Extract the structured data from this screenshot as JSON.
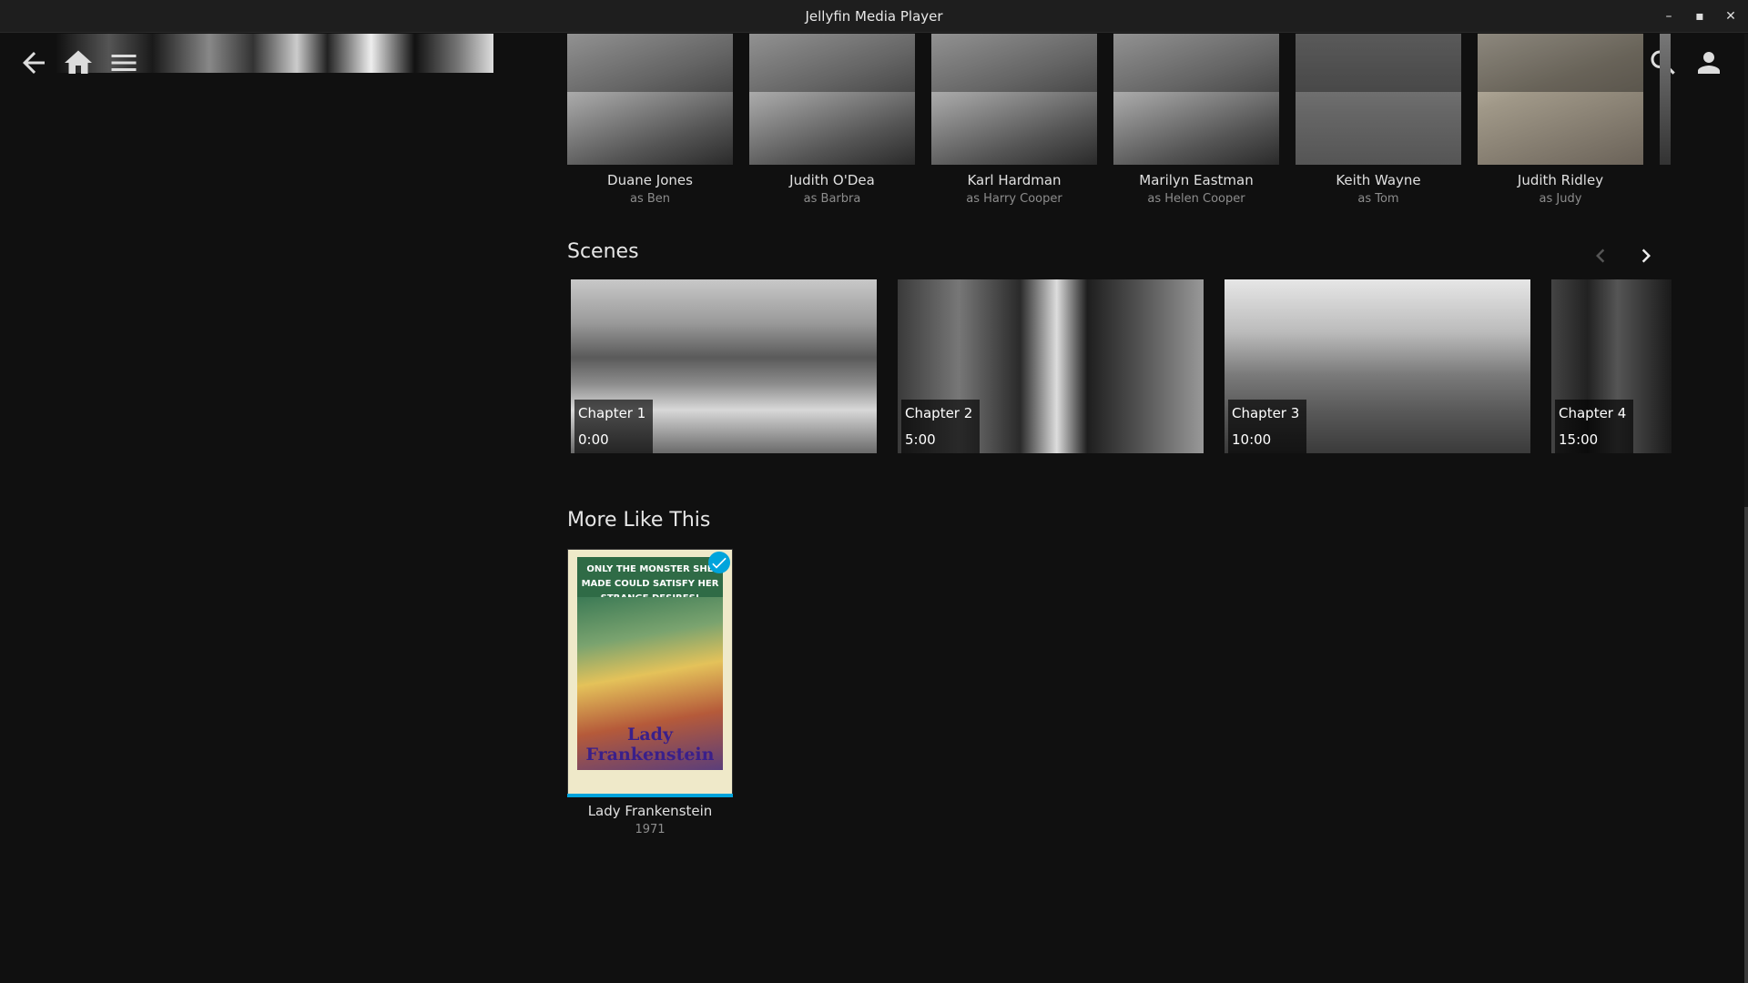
{
  "window": {
    "title": "Jellyfin Media Player"
  },
  "header": {
    "icons": [
      "back-arrow-icon",
      "home-icon",
      "menu-icon",
      "syncplay-icon",
      "cast-icon",
      "search-icon",
      "user-icon"
    ]
  },
  "cast": [
    {
      "name": "Duane Jones",
      "role": "as Ben"
    },
    {
      "name": "Judith O'Dea",
      "role": "as Barbra"
    },
    {
      "name": "Karl Hardman",
      "role": "as Harry Cooper"
    },
    {
      "name": "Marilyn Eastman",
      "role": "as Helen Cooper"
    },
    {
      "name": "Keith Wayne",
      "role": "as Tom"
    },
    {
      "name": "Judith Ridley",
      "role": "as Judy"
    }
  ],
  "scenes": {
    "title": "Scenes",
    "items": [
      {
        "name": "Chapter 1",
        "time": "0:00"
      },
      {
        "name": "Chapter 2",
        "time": "5:00"
      },
      {
        "name": "Chapter 3",
        "time": "10:00"
      },
      {
        "name": "Chapter 4",
        "time": "15:00"
      }
    ]
  },
  "more_like_this": {
    "title": "More Like This",
    "items": [
      {
        "title": "Lady Frankenstein",
        "year": "1971",
        "played": true,
        "progress": 1.0,
        "poster_tagline": "ONLY THE MONSTER SHE MADE COULD SATISFY HER STRANGE DESIRES!",
        "poster_title": "Lady Frankenstein"
      }
    ]
  },
  "colors": {
    "accent": "#00a4dc",
    "background": "#101010"
  }
}
